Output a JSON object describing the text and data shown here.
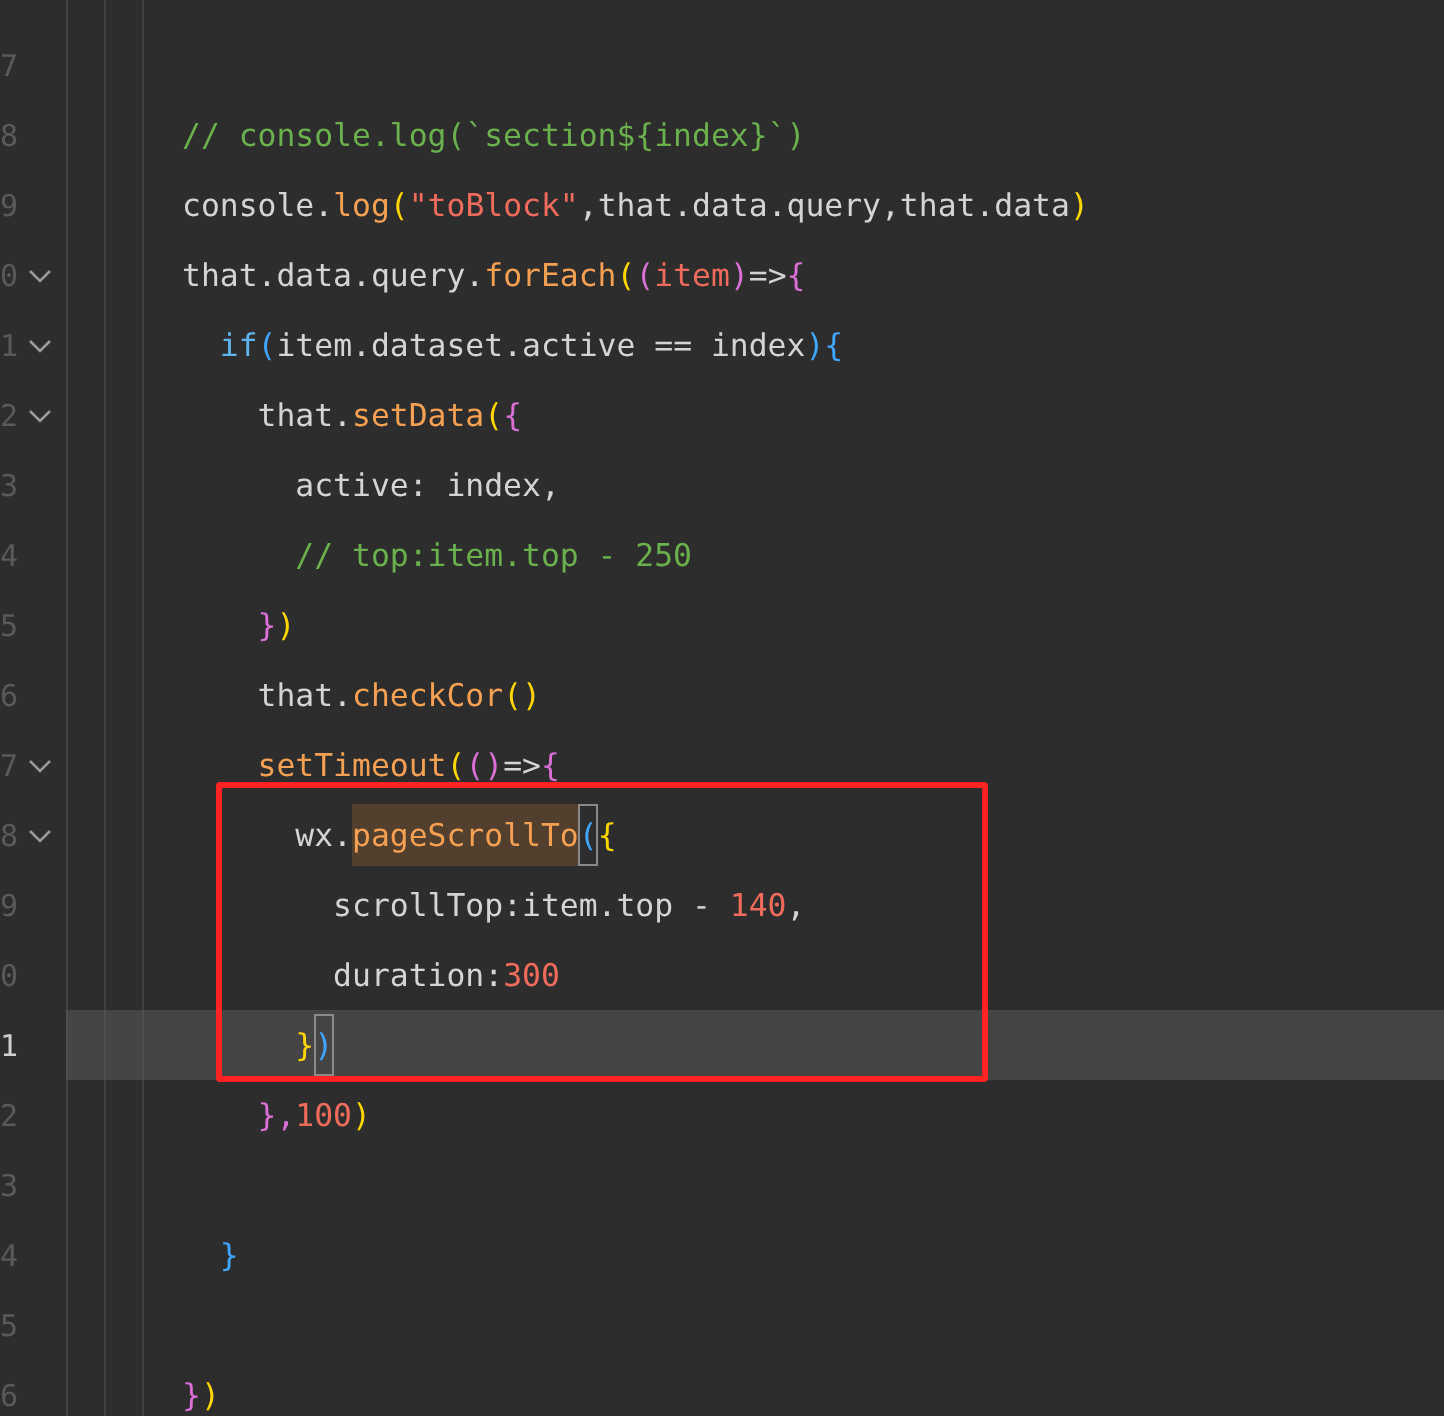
{
  "editor": {
    "lines": [
      {
        "number": "7"
      },
      {
        "number": "8",
        "tokens": [
          {
            "text": "// console.log(`section${index}`)",
            "kind": "comment"
          }
        ]
      },
      {
        "number": "9",
        "tokens": [
          {
            "text": "console.",
            "kind": "plain"
          },
          {
            "text": "log",
            "kind": "function"
          },
          {
            "text": "(",
            "kind": "bracket1"
          },
          {
            "text": "\"toBlock\"",
            "kind": "string"
          },
          {
            "text": ",that.data.query,that.data",
            "kind": "plain"
          },
          {
            "text": ")",
            "kind": "bracket1"
          }
        ]
      },
      {
        "number": "0",
        "foldable": true,
        "tokens": [
          {
            "text": "that.data.query.",
            "kind": "plain"
          },
          {
            "text": "forEach",
            "kind": "function"
          },
          {
            "text": "(",
            "kind": "bracket1"
          },
          {
            "text": "(",
            "kind": "bracket2"
          },
          {
            "text": "item",
            "kind": "string"
          },
          {
            "text": ")",
            "kind": "bracket2"
          },
          {
            "text": "=>",
            "kind": "plain"
          },
          {
            "text": "{",
            "kind": "bracket2"
          }
        ]
      },
      {
        "number": "1",
        "foldable": true,
        "tokens": [
          {
            "text": "  if",
            "kind": "keyword"
          },
          {
            "text": "(",
            "kind": "bracket3"
          },
          {
            "text": "item.dataset.active == index",
            "kind": "plain"
          },
          {
            "text": "){",
            "kind": "bracket3"
          }
        ]
      },
      {
        "number": "2",
        "foldable": true,
        "tokens": [
          {
            "text": "    that.",
            "kind": "plain"
          },
          {
            "text": "setData",
            "kind": "function"
          },
          {
            "text": "(",
            "kind": "bracket1"
          },
          {
            "text": "{",
            "kind": "bracket2"
          }
        ]
      },
      {
        "number": "3",
        "tokens": [
          {
            "text": "      active: index,",
            "kind": "plain"
          }
        ]
      },
      {
        "number": "4",
        "tokens": [
          {
            "text": "      // top:item.top - 250",
            "kind": "comment"
          }
        ]
      },
      {
        "number": "5",
        "tokens": [
          {
            "text": "    }",
            "kind": "bracket2"
          },
          {
            "text": ")",
            "kind": "bracket1"
          }
        ]
      },
      {
        "number": "6",
        "tokens": [
          {
            "text": "    that.",
            "kind": "plain"
          },
          {
            "text": "checkCor",
            "kind": "function"
          },
          {
            "text": "()",
            "kind": "bracket1"
          }
        ]
      },
      {
        "number": "7",
        "foldable": true,
        "tokens": [
          {
            "text": "    setTimeout",
            "kind": "function"
          },
          {
            "text": "(",
            "kind": "bracket1"
          },
          {
            "text": "()",
            "kind": "bracket2"
          },
          {
            "text": "=>",
            "kind": "plain"
          },
          {
            "text": "{",
            "kind": "bracket2"
          }
        ]
      },
      {
        "number": "8",
        "foldable": true,
        "boxed": true,
        "tokens": [
          {
            "text": "      wx.",
            "kind": "plain"
          },
          {
            "text": "pageScrollTo",
            "kind": "function",
            "highlighted": true
          },
          {
            "text": "(",
            "kind": "bracket3",
            "matched": true
          },
          {
            "text": "{",
            "kind": "bracket1"
          }
        ]
      },
      {
        "number": "9",
        "boxed": true,
        "tokens": [
          {
            "text": "        scrollTop:item.top - ",
            "kind": "plain"
          },
          {
            "text": "140",
            "kind": "number"
          },
          {
            "text": ",",
            "kind": "plain"
          }
        ]
      },
      {
        "number": "0",
        "boxed": true,
        "tokens": [
          {
            "text": "        duration:",
            "kind": "plain"
          },
          {
            "text": "300",
            "kind": "number"
          }
        ]
      },
      {
        "number": "1",
        "boxed": true,
        "current": true,
        "tokens": [
          {
            "text": "      }",
            "kind": "bracket1"
          },
          {
            "text": ")",
            "kind": "bracket3",
            "matched": true
          }
        ]
      },
      {
        "number": "2",
        "tokens": [
          {
            "text": "    },",
            "kind": "bracket2"
          },
          {
            "text": "100",
            "kind": "number"
          },
          {
            "text": ")",
            "kind": "bracket1"
          }
        ]
      },
      {
        "number": "3"
      },
      {
        "number": "4",
        "tokens": [
          {
            "text": "  }",
            "kind": "bracket3"
          }
        ]
      },
      {
        "number": "5"
      },
      {
        "number": "6",
        "tokens": [
          {
            "text": "}",
            "kind": "bracket2"
          },
          {
            "text": ")",
            "kind": "bracket1"
          }
        ]
      }
    ],
    "annotation": {
      "kind": "rectangle",
      "color": "#ff2424"
    }
  }
}
